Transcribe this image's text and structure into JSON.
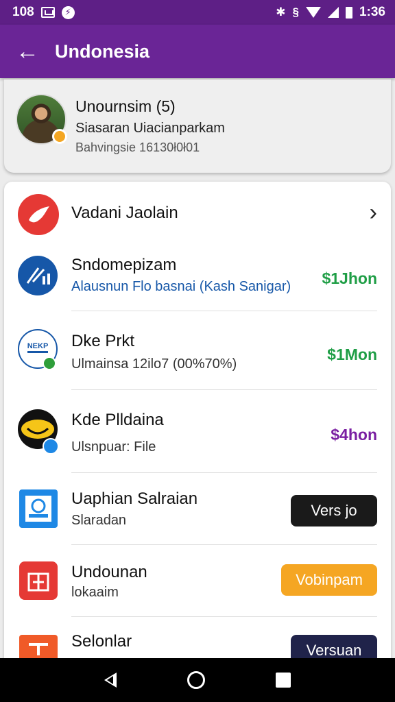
{
  "status_bar": {
    "left_text": "108",
    "time": "1:36",
    "icons": [
      "grid-icon",
      "flash-icon",
      "bluetooth-icon",
      "vibrate-icon",
      "wifi-icon",
      "signal-icon",
      "battery-icon"
    ]
  },
  "app_bar": {
    "back_icon": "arrow-left-icon",
    "title": "Undonesia"
  },
  "profile": {
    "name": "Unournsim (5)",
    "subtitle": "Siasaran Uiacianparkam",
    "meta": "Bahvingsie 16130ł0ł01",
    "badge_color": "#f4a623"
  },
  "list": [
    {
      "title": "Vadani Jaolain",
      "sub": "",
      "price": "",
      "action": "",
      "icon": "red-bird-icon"
    },
    {
      "title": "Sndomepizam",
      "sub": "Alausnun Flo basnai (Kash Sanigar)",
      "price": "$1Jhon",
      "action": "",
      "icon": "blue-chart-icon"
    },
    {
      "title": "Dke Prkt",
      "sub": "Ulmainsa 12ilo7 (00%70%)",
      "price": "$1Mon",
      "action": "",
      "icon": "nekp-badge-icon"
    },
    {
      "title": "Kde Plldaina",
      "sub": "Ulsnpuar: File",
      "price": "$4hon",
      "action": "",
      "icon": "yellow-smile-icon"
    },
    {
      "title": "Uaphian Salraian",
      "sub": "Slaradan",
      "price": "",
      "action": "Vers jo",
      "icon": "blue-card-icon"
    },
    {
      "title": "Undounan",
      "sub": "lokaaim",
      "price": "",
      "action": "Vobinpam",
      "icon": "red-gift-icon"
    },
    {
      "title": "Selonlar",
      "sub": "",
      "price": "",
      "action": "Versuan",
      "icon": "orange-box-icon"
    }
  ],
  "colors": {
    "status_bar": "#5e1f86",
    "app_bar": "#6a2596",
    "green_price": "#1f9e46",
    "purple_price": "#7a1fa2",
    "pill_dark": "#1a1a1a",
    "pill_orange": "#f5a623",
    "pill_navy": "#20234a"
  },
  "nav": {
    "back_icon": "nav-back-icon",
    "home_icon": "nav-home-icon",
    "recent_icon": "nav-recents-icon"
  }
}
